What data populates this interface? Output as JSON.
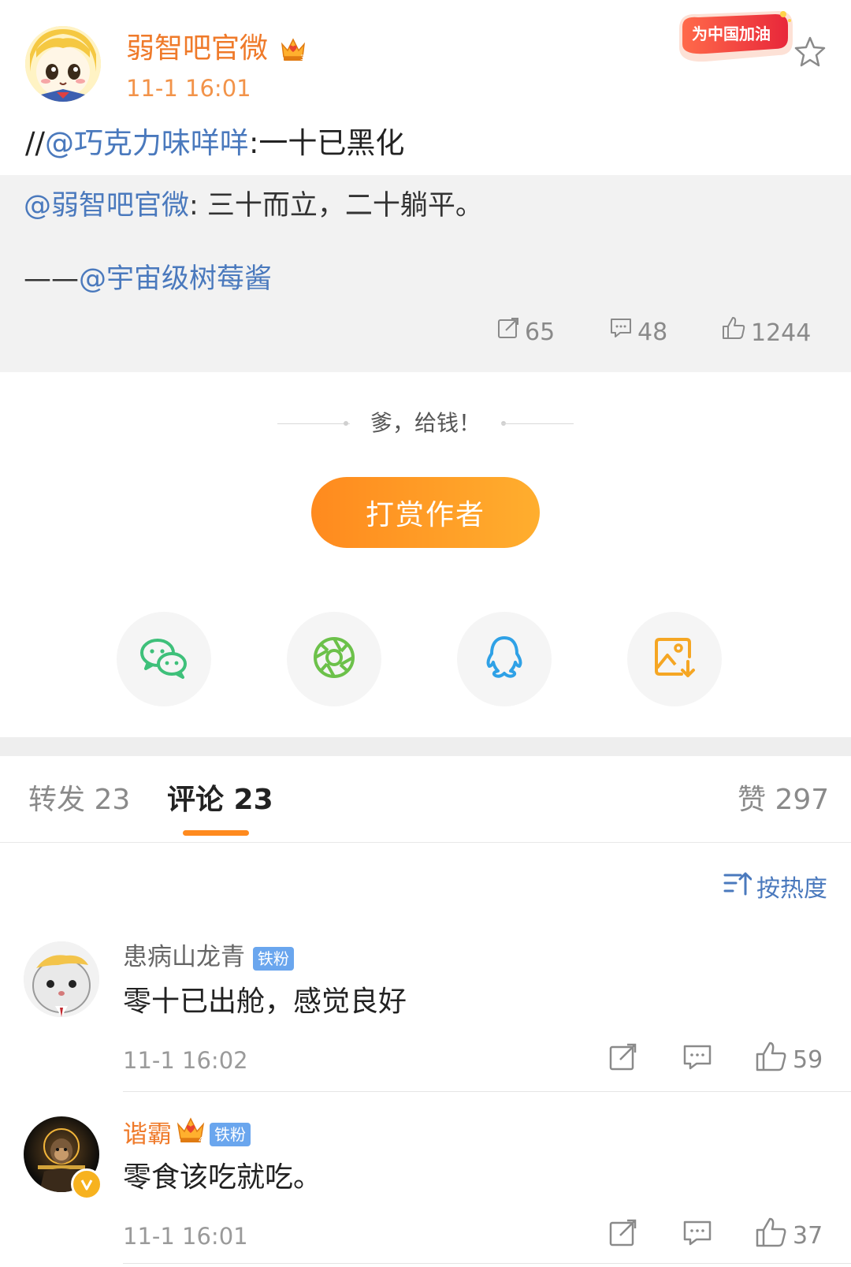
{
  "post": {
    "author": "弱智吧官微",
    "time": "11-1 16:01",
    "badge_label": "为中国加油",
    "crown_level": "3",
    "repost_prefix": "//",
    "repost_mention": "@巧克力味咩咩",
    "repost_text": ":一十已黑化"
  },
  "quoted": {
    "author_mention": "@弱智吧官微",
    "text": ": 三十而立，二十躺平。",
    "credit_prefix": "——",
    "credit_mention": "@宇宙级树莓酱",
    "reposts": "65",
    "comments": "48",
    "likes": "1244"
  },
  "reward": {
    "slogan": "爹，给钱！",
    "button_label": "打赏作者"
  },
  "share": {
    "items": [
      "wechat-icon",
      "moments-icon",
      "qq-icon",
      "save-image-icon"
    ],
    "colors": {
      "wechat": "#3ec07a",
      "moments": "#6cc14a",
      "qq": "#2fa1e6",
      "save": "#f5a623"
    }
  },
  "tabs": {
    "repost": "转发 23",
    "comment": "评论 23",
    "like": "赞 297"
  },
  "sort_label": "按热度",
  "comments": [
    {
      "name": "患病山龙青",
      "fan_tag": "铁粉",
      "text": "零十已出舱，感觉良好",
      "time": "11-1 16:02",
      "likes": "59"
    },
    {
      "name": "谐霸",
      "fan_tag": "铁粉",
      "crown_level": "4",
      "text": "零食该吃就吃。",
      "time": "11-1 16:01",
      "likes": "37"
    }
  ],
  "colors": {
    "accent": "#ff8a1e",
    "link": "#4a79bd",
    "vip_name": "#ef7a2a"
  }
}
